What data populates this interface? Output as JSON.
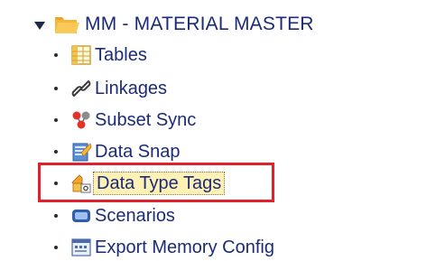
{
  "tree": {
    "root": {
      "label": "MM - MATERIAL MASTER",
      "icon": "folder-open-icon",
      "expanded": true
    },
    "items": [
      {
        "label": "Tables",
        "icon": "table-icon"
      },
      {
        "label": "Linkages",
        "icon": "link-icon"
      },
      {
        "label": "Subset Sync",
        "icon": "subset-sync-icon"
      },
      {
        "label": "Data Snap",
        "icon": "data-snap-icon"
      },
      {
        "label": "Data Type Tags",
        "icon": "data-type-tags-icon",
        "selected": true
      },
      {
        "label": "Scenarios",
        "icon": "scenarios-icon"
      },
      {
        "label": "Export Memory Config",
        "icon": "export-memory-config-icon"
      }
    ]
  },
  "colors": {
    "text": "#1b2b78",
    "folder": "#f5a623",
    "selection_bg": "#fdf1b5",
    "highlight_border": "#e0202a"
  }
}
